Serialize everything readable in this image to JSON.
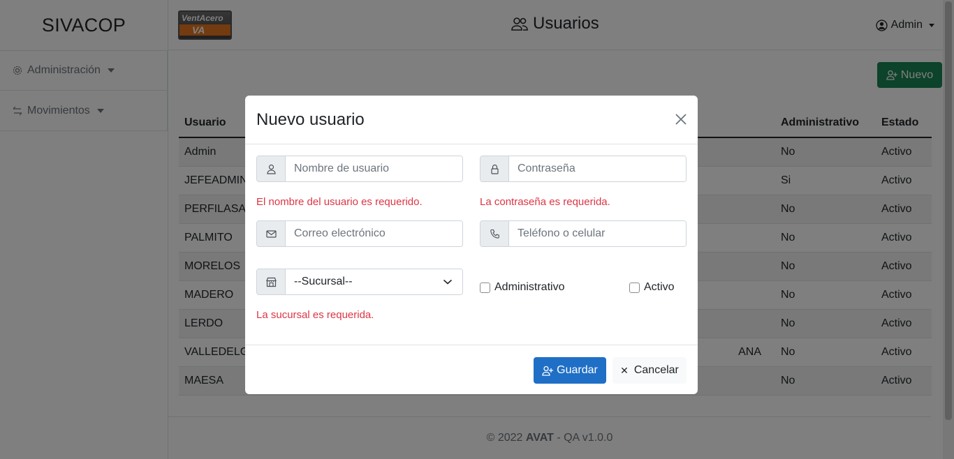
{
  "app": {
    "brand": "SIVACOP",
    "logo_text_a": "Vent",
    "logo_text_b": "Acero",
    "logo_mark": "VA"
  },
  "sidebar": {
    "items": [
      {
        "label": "Administración",
        "icon": "gear-icon"
      },
      {
        "label": "Movimientos",
        "icon": "arrows-swap-icon"
      }
    ]
  },
  "header": {
    "title": "Usuarios",
    "user": "Admin"
  },
  "toolbar": {
    "new_label": "Nuevo"
  },
  "table": {
    "columns": [
      "Usuario",
      "Administrativo",
      "Estado"
    ],
    "rows": [
      {
        "usuario": "Admin",
        "mid": "",
        "administrativo": "No",
        "estado": "Activo"
      },
      {
        "usuario": "JEFEADMINI",
        "mid": "",
        "administrativo": "Si",
        "estado": "Activo"
      },
      {
        "usuario": "PERFILASA",
        "mid": "",
        "administrativo": "No",
        "estado": "Activo"
      },
      {
        "usuario": "PALMITO",
        "mid": "",
        "administrativo": "No",
        "estado": "Activo"
      },
      {
        "usuario": "MORELOS",
        "mid": "",
        "administrativo": "No",
        "estado": "Activo"
      },
      {
        "usuario": "MADERO",
        "mid": "",
        "administrativo": "No",
        "estado": "Activo"
      },
      {
        "usuario": "LERDO",
        "mid": "",
        "administrativo": "No",
        "estado": "Activo"
      },
      {
        "usuario": "VALLEDELG",
        "mid": "ANA",
        "administrativo": "No",
        "estado": "Activo"
      },
      {
        "usuario": "MAESA",
        "mid": "",
        "administrativo": "No",
        "estado": "Activo"
      }
    ]
  },
  "footer": {
    "prefix": "© 2022 ",
    "company": "AVAT",
    "suffix": " - QA v1.0.0"
  },
  "modal": {
    "title": "Nuevo usuario",
    "username_placeholder": "Nombre de usuario",
    "password_placeholder": "Contraseña",
    "email_placeholder": "Correo electrónico",
    "phone_placeholder": "Teléfono o celular",
    "branch_selected": "--Sucursal--",
    "username_error": "El nombre del usuario es requerido.",
    "password_error": "La contraseña es requerida.",
    "branch_error": "La sucursal es requerida.",
    "admin_checkbox": "Administrativo",
    "active_checkbox": "Activo",
    "save_label": "Guardar",
    "cancel_label": "Cancelar"
  },
  "colors": {
    "success": "#198754",
    "primary": "#1f6fc6",
    "danger": "#dc3545"
  }
}
